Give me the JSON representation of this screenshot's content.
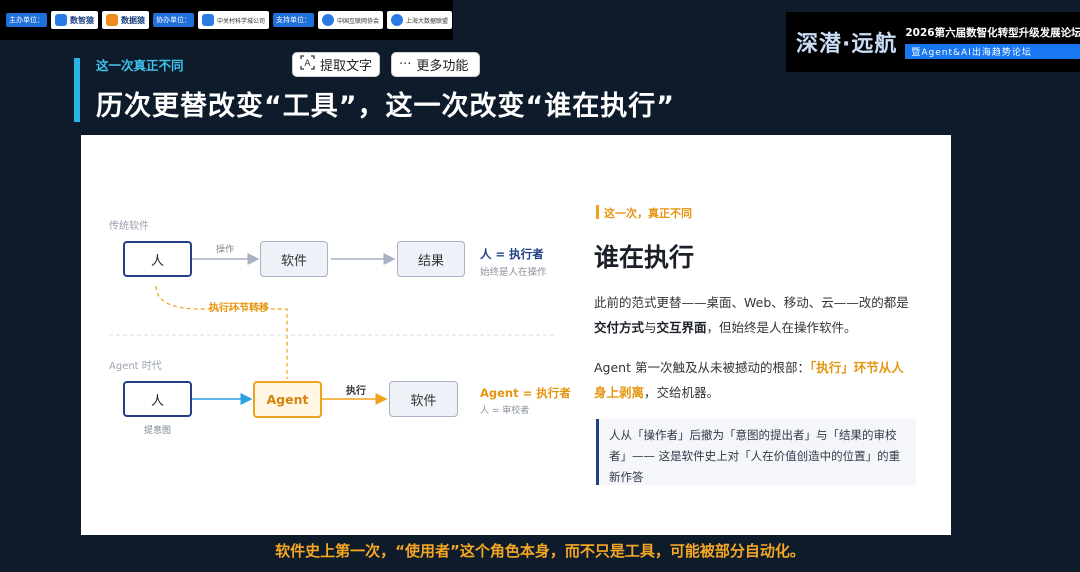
{
  "sponsors": {
    "host_label": "主办单位：",
    "host_logos": [
      "数智猿",
      "数据猿"
    ],
    "cohost_label": "协办单位：",
    "cohost_logos": [
      "中关村科学城公司"
    ],
    "support_label": "支持单位：",
    "support_logos": [
      "中国互联网协会",
      "上海大数据联盟"
    ]
  },
  "forum": {
    "brand": "深潜·远航",
    "title": "2026第六届数智化转型升级发展论坛",
    "subtitle": "暨Agent&AI出海趋势论坛"
  },
  "toolbar": {
    "extract_label": "提取文字",
    "more_label": "更多功能"
  },
  "slide": {
    "kicker": "这一次真正不同",
    "title": "历次更替改变“工具”，这一次改变“谁在执行”",
    "diagram": {
      "traditional_label": "传统软件",
      "person": "人",
      "operate": "操作",
      "software": "软件",
      "result": "结果",
      "role_main": "人 = 执行者",
      "role_sub": "始终是人在操作",
      "transfer": "执行环节转移",
      "agent_era_label": "Agent 时代",
      "agent_person": "人",
      "intent": "提意图",
      "agent": "Agent",
      "execute": "执行",
      "agent_software": "软件",
      "agent_role_main": "Agent = 执行者",
      "agent_role_sub": "人 = 审校者"
    },
    "right": {
      "kicker": "这一次，真正不同",
      "title": "谁在执行",
      "p1_a": "此前的范式更替——桌面、Web、移动、云——改的都是",
      "p1_b1": "交付方式",
      "p1_c": "与",
      "p1_b2": "交互界面",
      "p1_d": "，但始终是人在操作软件。",
      "p2_a": "Agent 第一次触及从未被撼动的根部：",
      "p2_hl": "「执行」环节从人身上剥离",
      "p2_b": "，交给机器。",
      "quote": "人从「操作者」后撤为「意图的提出者」与「结果的审校者」—— 这是软件史上对「人在价值创造中的位置」的重新作答"
    }
  },
  "caption": "软件史上第一次，“使用者”这个角色本身，而不只是工具，可能被部分自动化。",
  "colors": {
    "navy": "#22408a",
    "orange": "#f0a21c",
    "cyan": "#2bb3e6",
    "caption": "#f5a623"
  }
}
